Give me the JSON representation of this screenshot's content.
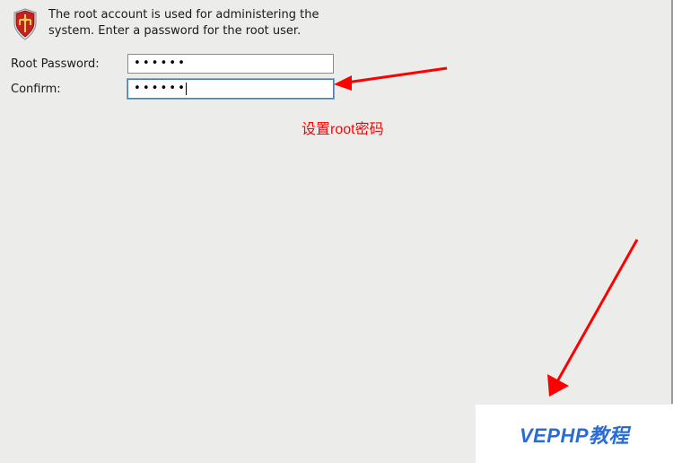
{
  "header": {
    "description": "The root account is used for administering the system.  Enter a password for the root user."
  },
  "form": {
    "password_label": "Root Password:",
    "password_value": "••••••",
    "confirm_label": "Confirm:",
    "confirm_value": "••••••"
  },
  "annotations": {
    "text": "设置root密码"
  },
  "watermark": {
    "text": "VEPHP教程"
  },
  "icons": {
    "shield": "root-shield-icon"
  },
  "colors": {
    "annotation": "#ff0000",
    "watermark_text": "#2b6cd4",
    "background": "#ececea"
  }
}
